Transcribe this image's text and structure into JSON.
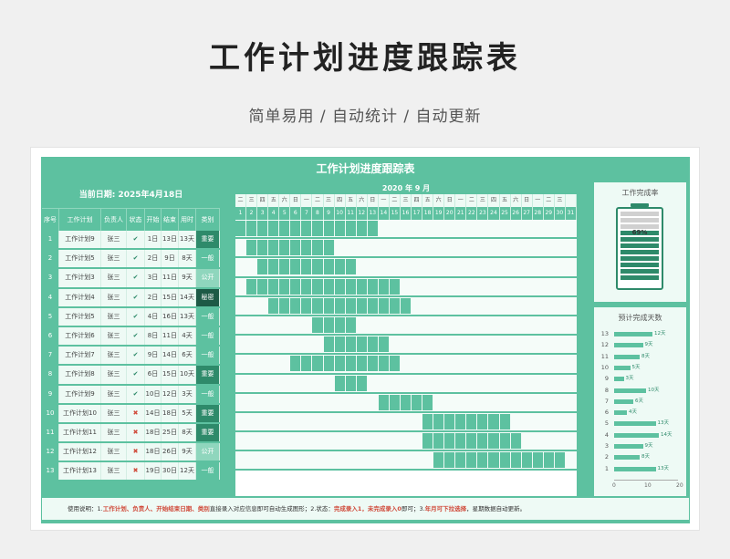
{
  "hero": {
    "title": "工作计划进度跟踪表",
    "subtitle": "简单易用 / 自动统计 / 自动更新"
  },
  "sheet": {
    "title": "工作计划进度跟踪表",
    "current_date": "当前日期:   2025年4月18日",
    "headers": [
      "序号",
      "工作计划",
      "负责人",
      "状态",
      "开始",
      "结束",
      "用时",
      "类别"
    ],
    "month_label": "2020 年   9   月",
    "weekdays": [
      "二",
      "三",
      "四",
      "五",
      "六",
      "日",
      "一",
      "二",
      "三",
      "四",
      "五",
      "六",
      "日",
      "一",
      "二",
      "三",
      "四",
      "五",
      "六",
      "日",
      "一",
      "二",
      "三",
      "四",
      "五",
      "六",
      "日",
      "一",
      "二",
      "三"
    ],
    "days": [
      "1",
      "2",
      "3",
      "4",
      "5",
      "6",
      "7",
      "8",
      "9",
      "10",
      "11",
      "12",
      "13",
      "14",
      "15",
      "16",
      "17",
      "18",
      "19",
      "20",
      "21",
      "22",
      "23",
      "24",
      "25",
      "26",
      "27",
      "28",
      "29",
      "30",
      "31"
    ],
    "rows": [
      {
        "no": "1",
        "name": "工作计划9",
        "owner": "张三",
        "status": "done",
        "start": "1日",
        "end": "13日",
        "dur": "13天",
        "cat": "重要",
        "s": 1,
        "e": 13
      },
      {
        "no": "2",
        "name": "工作计划5",
        "owner": "张三",
        "status": "done",
        "start": "2日",
        "end": "9日",
        "dur": "8天",
        "cat": "一般",
        "s": 2,
        "e": 9
      },
      {
        "no": "3",
        "name": "工作计划3",
        "owner": "张三",
        "status": "done",
        "start": "3日",
        "end": "11日",
        "dur": "9天",
        "cat": "公开",
        "s": 3,
        "e": 11
      },
      {
        "no": "4",
        "name": "工作计划4",
        "owner": "张三",
        "status": "done",
        "start": "2日",
        "end": "15日",
        "dur": "14天",
        "cat": "秘密",
        "s": 2,
        "e": 15
      },
      {
        "no": "5",
        "name": "工作计划5",
        "owner": "张三",
        "status": "done",
        "start": "4日",
        "end": "16日",
        "dur": "13天",
        "cat": "一般",
        "s": 4,
        "e": 16
      },
      {
        "no": "6",
        "name": "工作计划6",
        "owner": "张三",
        "status": "done",
        "start": "8日",
        "end": "11日",
        "dur": "4天",
        "cat": "一般",
        "s": 8,
        "e": 11
      },
      {
        "no": "7",
        "name": "工作计划7",
        "owner": "张三",
        "status": "done",
        "start": "9日",
        "end": "14日",
        "dur": "6天",
        "cat": "一般",
        "s": 9,
        "e": 14
      },
      {
        "no": "8",
        "name": "工作计划8",
        "owner": "张三",
        "status": "done",
        "start": "6日",
        "end": "15日",
        "dur": "10天",
        "cat": "重要",
        "s": 6,
        "e": 15
      },
      {
        "no": "9",
        "name": "工作计划9",
        "owner": "张三",
        "status": "done",
        "start": "10日",
        "end": "12日",
        "dur": "3天",
        "cat": "一般",
        "s": 10,
        "e": 12
      },
      {
        "no": "10",
        "name": "工作计划10",
        "owner": "张三",
        "status": "todo",
        "start": "14日",
        "end": "18日",
        "dur": "5天",
        "cat": "重要",
        "s": 14,
        "e": 18
      },
      {
        "no": "11",
        "name": "工作计划11",
        "owner": "张三",
        "status": "todo",
        "start": "18日",
        "end": "25日",
        "dur": "8天",
        "cat": "重要",
        "s": 18,
        "e": 25
      },
      {
        "no": "12",
        "name": "工作计划12",
        "owner": "张三",
        "status": "todo",
        "start": "18日",
        "end": "26日",
        "dur": "9天",
        "cat": "公开",
        "s": 18,
        "e": 26
      },
      {
        "no": "13",
        "name": "工作计划13",
        "owner": "张三",
        "status": "todo",
        "start": "19日",
        "end": "30日",
        "dur": "12天",
        "cat": "一般",
        "s": 19,
        "e": 30
      }
    ],
    "status_icons": {
      "done": "✔",
      "todo": "✖"
    },
    "completion": {
      "title": "工作完成率",
      "label": "69%",
      "value": 0.69
    },
    "days_chart": {
      "title": "预计完成天数",
      "items": [
        {
          "label": "13",
          "value": 12,
          "text": "12天"
        },
        {
          "label": "12",
          "value": 9,
          "text": "9天"
        },
        {
          "label": "11",
          "value": 8,
          "text": "8天"
        },
        {
          "label": "10",
          "value": 5,
          "text": "5天"
        },
        {
          "label": "9",
          "value": 3,
          "text": "3天"
        },
        {
          "label": "8",
          "value": 10,
          "text": "10天"
        },
        {
          "label": "7",
          "value": 6,
          "text": "6天"
        },
        {
          "label": "6",
          "value": 4,
          "text": "4天"
        },
        {
          "label": "5",
          "value": 13,
          "text": "13天"
        },
        {
          "label": "4",
          "value": 14,
          "text": "14天"
        },
        {
          "label": "3",
          "value": 9,
          "text": "9天"
        },
        {
          "label": "2",
          "value": 8,
          "text": "8天"
        },
        {
          "label": "1",
          "value": 13,
          "text": "13天"
        }
      ],
      "ticks": [
        "0",
        "10",
        "20"
      ],
      "max": 20
    },
    "footer": {
      "p1": "使用说明：1.",
      "r1": "工作计划、负责人、开始结束日期、类别",
      "p2": "直接录入对应信息即可自动生成图形；2.状态：",
      "r2": "完成录入1，未完成录入0",
      "p3": "即可；3.",
      "r3": "年月可下拉选择",
      "p4": "，星期数据自动更新。"
    }
  }
}
